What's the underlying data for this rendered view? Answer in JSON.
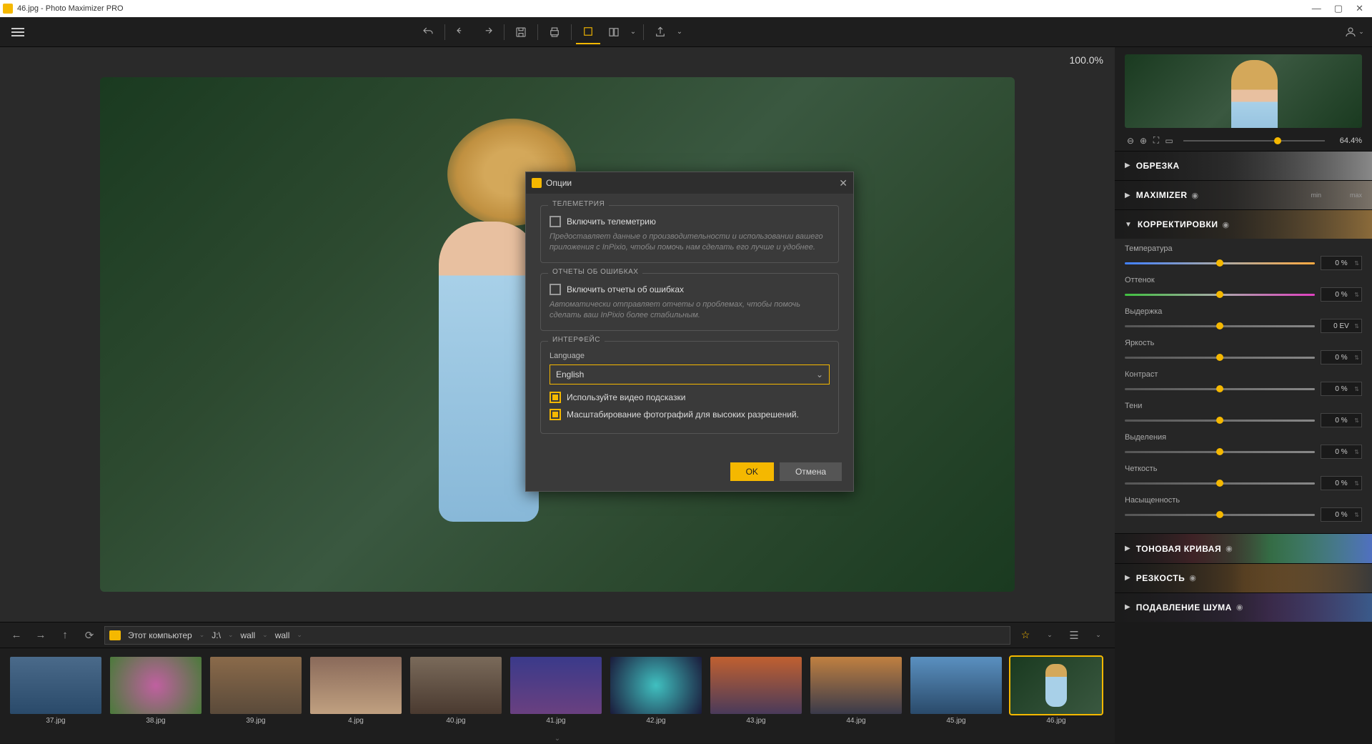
{
  "titlebar": {
    "filename": "46.jpg",
    "app": "Photo Maximizer PRO"
  },
  "canvas": {
    "zoom": "100.0%"
  },
  "preview": {
    "zoom": "64.4%"
  },
  "sections": {
    "crop": "ОБРЕЗКА",
    "maximizer": "MAXIMIZER",
    "adjustments": "КОРРЕКТИРОВКИ",
    "curve": "ТОНОВАЯ КРИВАЯ",
    "sharpness": "РЕЗКОСТЬ",
    "noise": "ПОДАВЛЕНИЕ ШУМА",
    "max_min": "min",
    "max_max": "max"
  },
  "adj": {
    "temperature": {
      "label": "Температура",
      "value": "0 %"
    },
    "tint": {
      "label": "Оттенок",
      "value": "0 %"
    },
    "exposure": {
      "label": "Выдержка",
      "value": "0 EV"
    },
    "brightness": {
      "label": "Яркость",
      "value": "0 %"
    },
    "contrast": {
      "label": "Контраст",
      "value": "0 %"
    },
    "shadows": {
      "label": "Тени",
      "value": "0 %"
    },
    "highlights": {
      "label": "Выделения",
      "value": "0 %"
    },
    "clarity": {
      "label": "Четкость",
      "value": "0 %"
    },
    "saturation": {
      "label": "Насыщенность",
      "value": "0 %"
    }
  },
  "nav": {
    "crumbs": [
      "Этот компьютер",
      "J:\\",
      "wall",
      "wall"
    ]
  },
  "thumbs": [
    {
      "name": "37.jpg",
      "cls": "t37"
    },
    {
      "name": "38.jpg",
      "cls": "t38"
    },
    {
      "name": "39.jpg",
      "cls": "t39"
    },
    {
      "name": "4.jpg",
      "cls": "t4"
    },
    {
      "name": "40.jpg",
      "cls": "t40"
    },
    {
      "name": "41.jpg",
      "cls": "t41"
    },
    {
      "name": "42.jpg",
      "cls": "t42"
    },
    {
      "name": "43.jpg",
      "cls": "t43"
    },
    {
      "name": "44.jpg",
      "cls": "t44"
    },
    {
      "name": "45.jpg",
      "cls": "t45"
    },
    {
      "name": "46.jpg",
      "cls": "t46",
      "active": true
    }
  ],
  "dialog": {
    "title": "Опции",
    "telemetry_legend": "ТЕЛЕМЕТРИЯ",
    "telemetry_chk": "Включить телеметрию",
    "telemetry_desc": "Предоставляет данные о производительности и использовании вашего приложения с InPixio, чтобы помочь нам сделать его лучше и удобнее.",
    "errors_legend": "ОТЧЕТЫ ОБ ОШИБКАХ",
    "errors_chk": "Включить отчеты об ошибках",
    "errors_desc": "Автоматически отправляет отчеты о проблемах, чтобы помочь сделать ваш InPixio более стабильным.",
    "interface_legend": "ИНТЕРФЕЙС",
    "language_label": "Language",
    "language_value": "English",
    "video_hints": "Используйте видео подсказки",
    "hires_scaling": "Масштабирование фотографий для высоких разрешений.",
    "ok": "OK",
    "cancel": "Отмена"
  }
}
